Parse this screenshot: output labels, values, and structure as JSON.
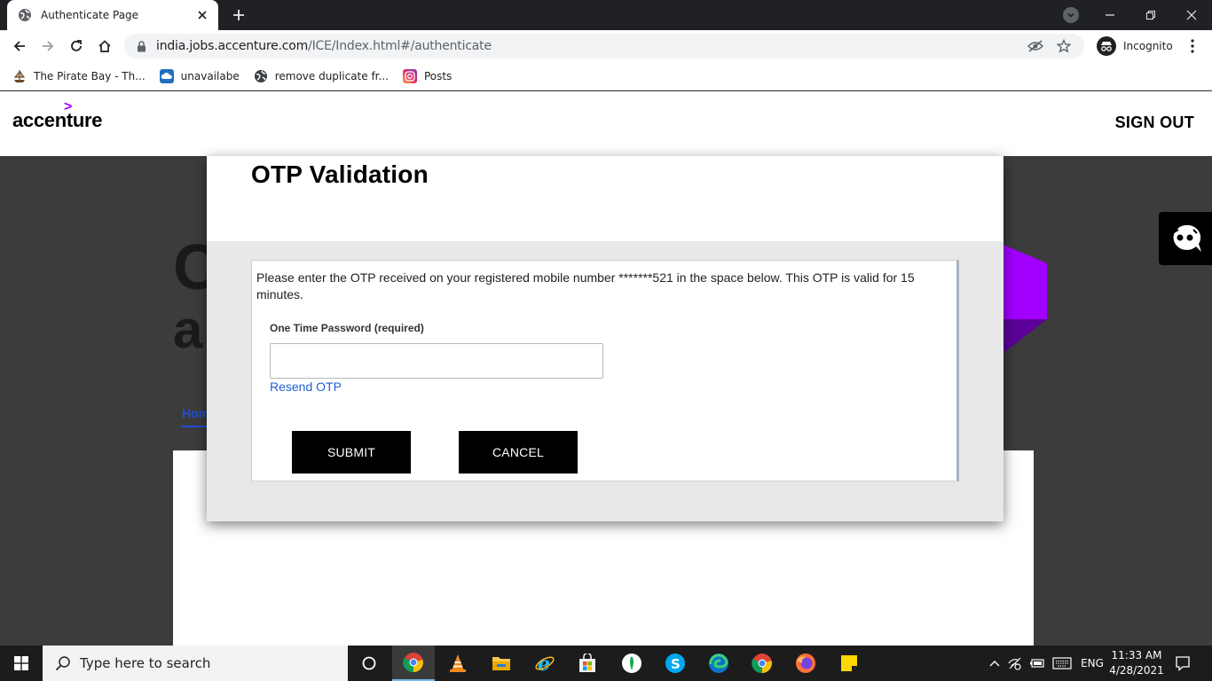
{
  "browser": {
    "tab": {
      "title": "Authenticate Page",
      "favicon": "globe-icon"
    },
    "address": {
      "host": "india.jobs.accenture.com",
      "path": "/ICE/Index.html#/authenticate"
    },
    "profile_label": "Incognito",
    "bookmarks": [
      {
        "label": "The Pirate Bay - Th...",
        "icon": "pirate-ship-icon"
      },
      {
        "label": "unavailabe",
        "icon": "cloud-icon"
      },
      {
        "label": "remove duplicate fr...",
        "icon": "globe-icon"
      },
      {
        "label": "Posts",
        "icon": "instagram-icon"
      }
    ]
  },
  "site": {
    "logo_mark": ">",
    "logo_text": "accenture",
    "signout_label": "SIGN OUT",
    "accent_color": "#a100ff",
    "background": {
      "big_letter_1": "C",
      "big_letter_2": "a",
      "home_link": "Home"
    }
  },
  "modal": {
    "title": "OTP Validation",
    "message": "Please enter the OTP received on your registered mobile number *******521 in the space below. This OTP is valid for 15 minutes.",
    "field_label": "One Time Password (required)",
    "field_value": "",
    "field_placeholder": "",
    "resend_label": "Resend OTP",
    "submit_label": "SUBMIT",
    "cancel_label": "CANCEL"
  },
  "taskbar": {
    "search_placeholder": "Type here to search",
    "apps": [
      "task-view-icon",
      "chrome-icon",
      "vlc-icon",
      "file-explorer-icon",
      "internet-explorer-icon",
      "microsoft-store-icon",
      "mongodb-compass-icon",
      "skype-icon",
      "edge-icon",
      "chrome-icon",
      "firefox-icon",
      "sticky-notes-icon"
    ],
    "language": "ENG",
    "time": "11:33 AM",
    "date": "4/28/2021"
  }
}
